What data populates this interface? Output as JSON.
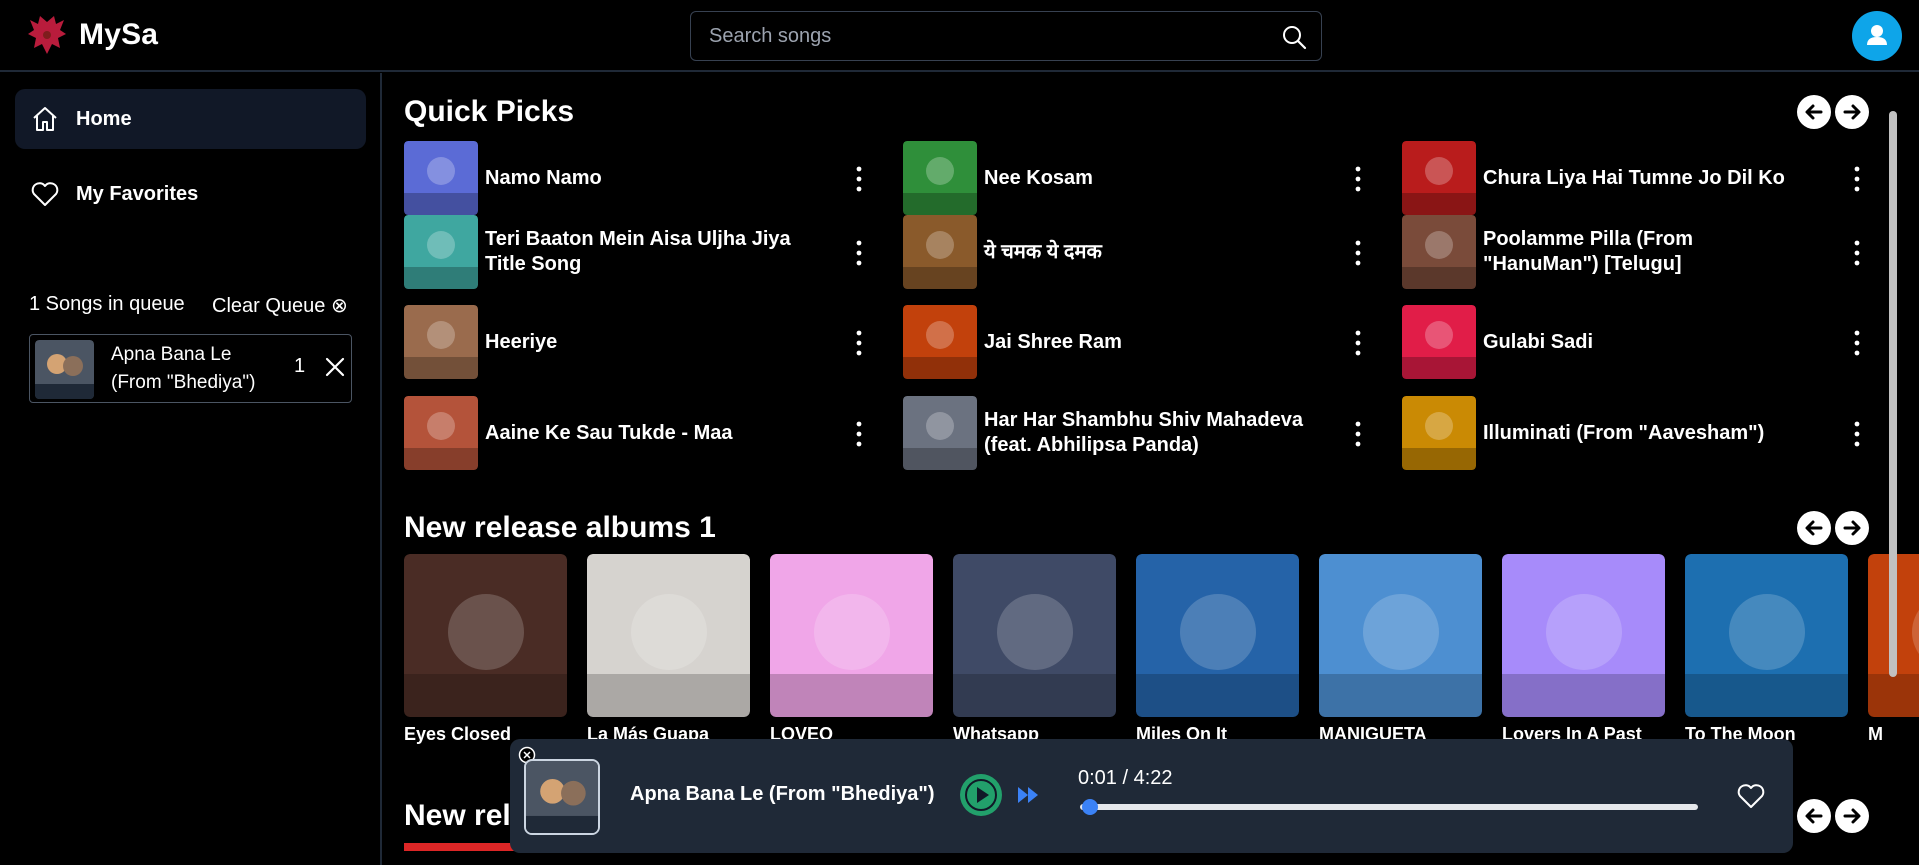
{
  "app": {
    "name": "MySa"
  },
  "search": {
    "placeholder": "Search songs"
  },
  "colors": {
    "accent": "#3b82f6",
    "play": "#22a06b",
    "avatar": "#0ea5e9",
    "panel": "#1f2937",
    "activeNav": "#111827"
  },
  "sidebar": {
    "nav": [
      {
        "label": "Home",
        "icon": "home-icon",
        "active": true
      },
      {
        "label": "My Favorites",
        "icon": "heart-icon",
        "active": false
      }
    ],
    "queue": {
      "count_label": "1 Songs in queue",
      "clear_label": "Clear Queue ⊗",
      "items": [
        {
          "title": "Apna Bana Le (From \"Bhediya\")",
          "position": "1"
        }
      ]
    }
  },
  "sections": {
    "quick_picks": {
      "title": "Quick Picks",
      "items": [
        {
          "title": "Namo Namo",
          "color": "#5b6bd6"
        },
        {
          "title": "Nee Kosam",
          "color": "#2f8f3a"
        },
        {
          "title": "Chura Liya Hai Tumne Jo Dil Ko",
          "color": "#b91c1c"
        },
        {
          "title": "Teri Baaton Mein Aisa Uljha Jiya Title Song",
          "color": "#3fa7a0"
        },
        {
          "title": "ये चमक ये दमक",
          "color": "#8a5a2b"
        },
        {
          "title": "Poolamme Pilla (From \"HanuMan\") [Telugu]",
          "color": "#7a4b3a"
        },
        {
          "title": "Heeriye",
          "color": "#9a6b4d"
        },
        {
          "title": "Jai Shree Ram",
          "color": "#c2410c"
        },
        {
          "title": "Gulabi Sadi",
          "color": "#e11d48"
        },
        {
          "title": "Aaine Ke Sau Tukde - Maa",
          "color": "#b4533a"
        },
        {
          "title": "Har Har Shambhu Shiv Mahadeva (feat. Abhilipsa Panda)",
          "color": "#6b7280"
        },
        {
          "title": "Illuminati (From \"Aavesham\")",
          "color": "#ca8a04"
        }
      ]
    },
    "new_releases": {
      "title": "New release albums 1",
      "albums": [
        {
          "name": "Eyes Closed",
          "color": "#4a2c25"
        },
        {
          "name": "La Más Guapa",
          "color": "#d6d3cf"
        },
        {
          "name": "LOVEO",
          "color": "#f0a6e8"
        },
        {
          "name": "Whatsapp",
          "color": "#3f4a66"
        },
        {
          "name": "Miles On It",
          "color": "#2563a8"
        },
        {
          "name": "MANIGUETA",
          "color": "#4d8fd1"
        },
        {
          "name": "Lovers In A Past",
          "color": "#a78bfa"
        },
        {
          "name": "To The Moon",
          "color": "#1d6fb0"
        },
        {
          "name": "M",
          "color": "#c2410c"
        }
      ]
    },
    "next_section": {
      "title": "New rel"
    }
  },
  "player": {
    "title": "Apna Bana Le (From \"Bhediya\")",
    "time": "0:01 / 4:22",
    "progress": 0.004
  }
}
